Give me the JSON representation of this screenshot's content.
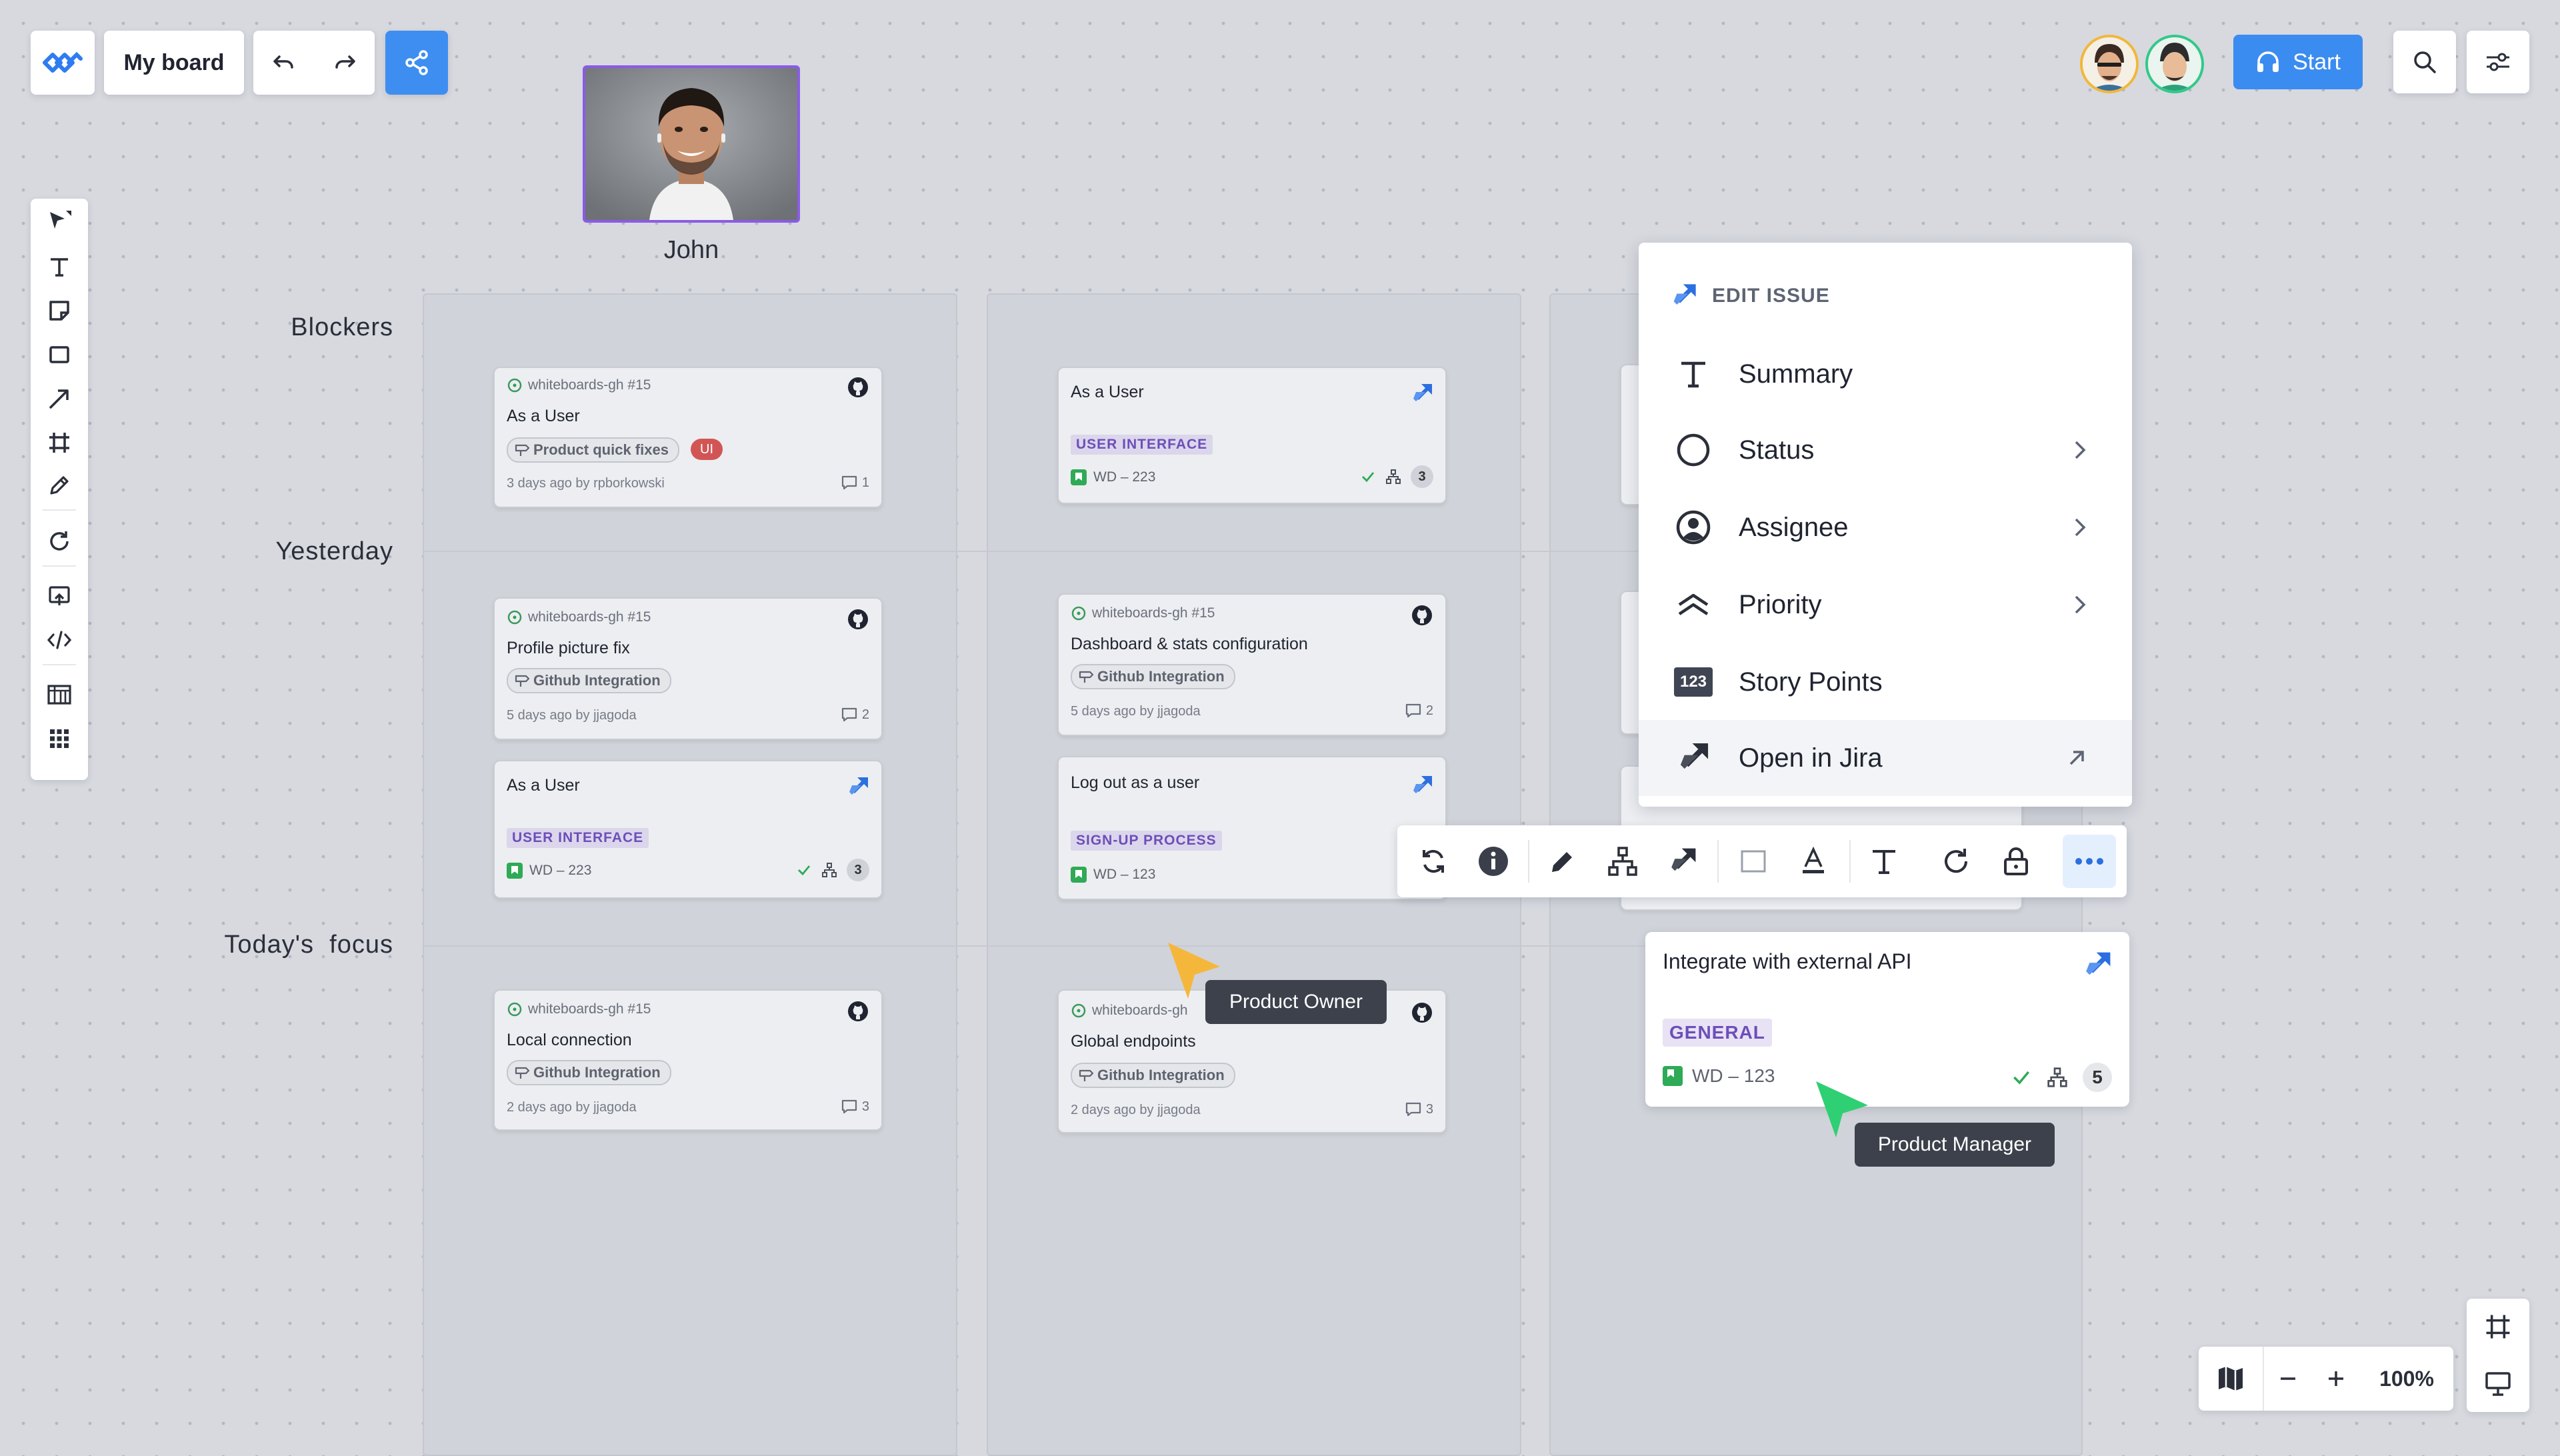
{
  "header": {
    "board_title": "My board",
    "start_label": "Start"
  },
  "portrait": {
    "name": "John"
  },
  "rows": {
    "blockers": "Blockers",
    "yesterday": "Yesterday",
    "today": "Today's  focus"
  },
  "cards": {
    "c1": {
      "source": "whiteboards-gh #15",
      "title": "As a User",
      "chip": "Product quick fixes",
      "tag": "UI",
      "byline": "3 days ago by rpborkowski",
      "comments": "1"
    },
    "c2": {
      "source": "whiteboards-gh #15",
      "title": "Profile picture fix",
      "chip": "Github Integration",
      "byline": "5 days ago by jjagoda",
      "comments": "2"
    },
    "c3": {
      "title": "As a User",
      "label": "USER INTERFACE",
      "key": "WD – 223",
      "count": "3"
    },
    "c4": {
      "source": "whiteboards-gh #15",
      "title": "Local connection",
      "chip": "Github Integration",
      "byline": "2 days ago by jjagoda",
      "comments": "3"
    },
    "c5": {
      "title": "As a User",
      "label": "USER INTERFACE",
      "key": "WD – 223",
      "count": "3"
    },
    "c6": {
      "source": "whiteboards-gh #15",
      "title": "Dashboard & stats configuration",
      "chip": "Github Integration",
      "byline": "5 days ago by jjagoda",
      "comments": "2"
    },
    "c7": {
      "title": "Log out as a user",
      "label": "SIGN-UP PROCESS",
      "key": "WD – 123"
    },
    "c8": {
      "source": "whiteboards-gh",
      "title": "Global endpoints",
      "chip": "Github Integration",
      "byline": "2 days ago by jjagoda",
      "comments": "3"
    }
  },
  "menu": {
    "heading": "EDIT ISSUE",
    "items": [
      {
        "label": "Summary",
        "icon": "text-icon"
      },
      {
        "label": "Status",
        "icon": "circle-icon"
      },
      {
        "label": "Assignee",
        "icon": "user-circle-icon"
      },
      {
        "label": "Priority",
        "icon": "priority-icon"
      },
      {
        "label": "Story Points",
        "icon": "story-points-icon",
        "badge": "123"
      },
      {
        "label": "Open in Jira",
        "icon": "jira-icon"
      }
    ]
  },
  "big_card": {
    "title": "Integrate with external API",
    "label": "GENERAL",
    "key": "WD – 123",
    "count": "5"
  },
  "cursors": {
    "owner": "Product Owner",
    "manager": "Product Manager"
  },
  "zoom": {
    "level": "100%"
  },
  "colors": {
    "accent": "#3b8cf0",
    "selection": "#8a5be8",
    "owner_cursor": "#f5b73b",
    "manager_cursor": "#2fcf73",
    "jira": "#2b6fe0",
    "label_purple": "#6c4fb8",
    "ui_tag": "#d25555"
  }
}
